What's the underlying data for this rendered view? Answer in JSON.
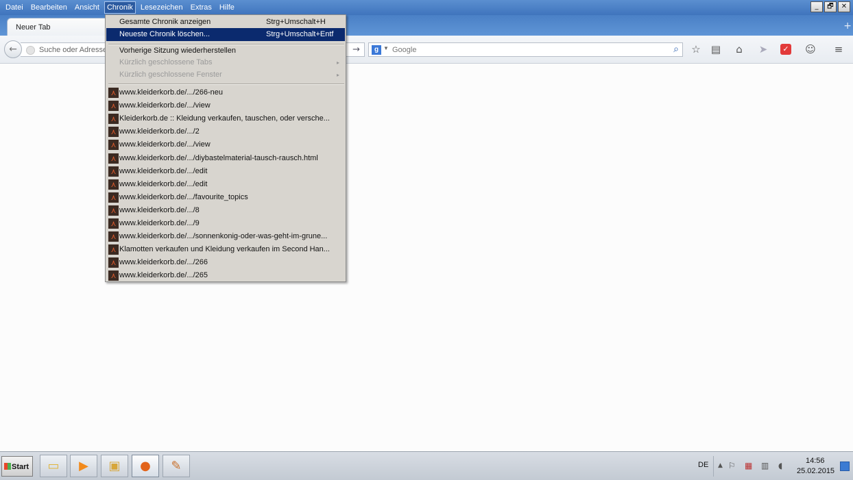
{
  "menubar": {
    "items": [
      "Datei",
      "Bearbeiten",
      "Ansicht",
      "Chronik",
      "Lesezeichen",
      "Extras",
      "Hilfe"
    ]
  },
  "window_controls": {
    "minimize": "_",
    "restore": "🗗",
    "close": "✕"
  },
  "tabs": [
    {
      "label": "Neuer Tab"
    }
  ],
  "newtab_icon": "+",
  "navbar": {
    "back_icon": "←",
    "url_placeholder": "Suche oder Adresse",
    "go_icon": "→",
    "search_engine": "g",
    "search_placeholder": "Google",
    "search_icon": "⌕",
    "icons": {
      "star": "☆",
      "reader": "▤",
      "home": "⌂",
      "send": "➤",
      "pocket": "✓",
      "chat": "☺",
      "menu": "≡"
    }
  },
  "chronik_menu": {
    "show_all": {
      "label": "Gesamte Chronik anzeigen",
      "shortcut": "Strg+Umschalt+H"
    },
    "clear_recent": {
      "label": "Neueste Chronik löschen...",
      "shortcut": "Strg+Umschalt+Entf"
    },
    "restore_session": "Vorherige Sitzung wiederherstellen",
    "recent_tabs": "Kürzlich geschlossene Tabs",
    "recent_windows": "Kürzlich geschlossene Fenster",
    "submenu_arrow": "▸",
    "history": [
      "www.kleiderkorb.de/.../266-neu",
      "www.kleiderkorb.de/.../view",
      "Kleiderkorb.de :: Kleidung verkaufen, tauschen, oder versche...",
      "www.kleiderkorb.de/.../2",
      "www.kleiderkorb.de/.../view",
      "www.kleiderkorb.de/.../diybastelmaterial-tausch-rausch.html",
      "www.kleiderkorb.de/.../edit",
      "www.kleiderkorb.de/.../edit",
      "www.kleiderkorb.de/.../favourite_topics",
      "www.kleiderkorb.de/.../8",
      "www.kleiderkorb.de/.../9",
      "www.kleiderkorb.de/.../sonnenkonig-oder-was-geht-im-grune...",
      "Klamotten verkaufen und Kleidung verkaufen im Second Han...",
      "www.kleiderkorb.de/.../266",
      "www.kleiderkorb.de/.../265"
    ],
    "favicon_glyph": "⋏"
  },
  "taskbar": {
    "start_label": "Start",
    "apps": [
      {
        "name": "explorer",
        "glyph": "▭"
      },
      {
        "name": "media-player",
        "glyph": "▶"
      },
      {
        "name": "folder",
        "glyph": "▣"
      },
      {
        "name": "firefox",
        "glyph": "●"
      },
      {
        "name": "paint",
        "glyph": "✎"
      }
    ],
    "language": "DE",
    "tray": {
      "up": "▲",
      "flag": "⚐",
      "action": "▦",
      "network": "▥",
      "volume": "◖"
    },
    "time": "14:56",
    "date": "25.02.2015"
  }
}
